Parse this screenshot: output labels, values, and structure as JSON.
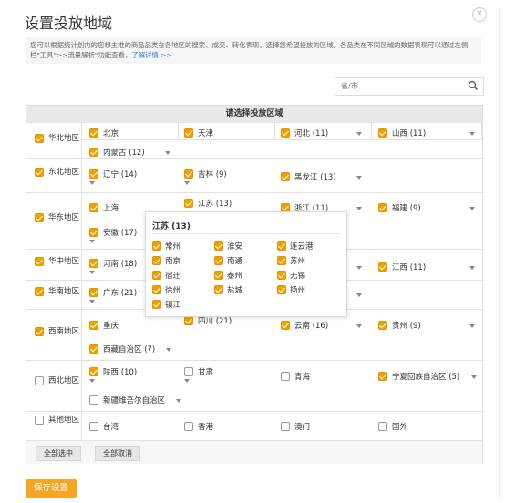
{
  "title": "设置投放地域",
  "close_icon": "close-icon",
  "description": "您可以根据统计划内的您想主推的商品品类在各地区的搜索、成交、转化表现，选择您希望投放的区域。各品类在不同区域的数据表现可以通过左侧栏\"工具\">>流量解析\"功能查看，",
  "description_link": "了解详情 >>",
  "search": {
    "placeholder": "省/市",
    "icon": "search-icon"
  },
  "panel_header": "请选择投放区域",
  "regions": [
    {
      "name": "华北地区",
      "checked": true
    },
    {
      "name": "东北地区",
      "checked": true
    },
    {
      "name": "华东地区",
      "checked": true
    },
    {
      "name": "华中地区",
      "checked": true
    },
    {
      "name": "华南地区",
      "checked": true
    },
    {
      "name": "西南地区",
      "checked": true
    },
    {
      "name": "西北地区",
      "checked": false
    },
    {
      "name": "其他地区",
      "checked": false
    }
  ],
  "provinces": {
    "beijing": "北京",
    "tianjin": "天津",
    "hebei": "河北 (11)",
    "shanxi": "山西 (11)",
    "neimenggu": "内蒙古 (12)",
    "liaoning": "辽宁 (14)",
    "jilin": "吉林 (9)",
    "heilongjiang": "黑龙江 (13)",
    "shanghai": "上海",
    "jiangsu": "江苏 (13)",
    "zhejiang": "浙江 (11)",
    "fujian": "福建 (9)",
    "anhui": "安徽 (17)",
    "henan": "河南 (18)",
    "jiangxi": "江西 (11)",
    "guangdong": "广东 (21)",
    "chongqing": "重庆",
    "sichuan": "四川 (21)",
    "yunnan": "云南 (16)",
    "guizhou": "贵州 (9)",
    "xizang": "西藏自治区 (7)",
    "shaanxi": "陕西 (10)",
    "gansu": "甘肃",
    "qinghai": "青海",
    "ningxia": "宁夏回族自治区 (5)",
    "xinjiang": "新疆维吾尔自治区",
    "taiwan": "台湾",
    "xianggang": "香港",
    "aomen": "澳门",
    "guowai": "国外"
  },
  "popup": {
    "title": "江苏 (13)",
    "cities": [
      "常州",
      "淮安",
      "连云港",
      "南京",
      "南通",
      "苏州",
      "宿迁",
      "泰州",
      "无锡",
      "徐州",
      "盐城",
      "扬州",
      "镇江"
    ]
  },
  "buttons": {
    "select_all": "全部选中",
    "cancel_all": "全部取消",
    "save": "保存设置"
  },
  "colors": {
    "accent": "#f5a623",
    "link": "#2a78d6"
  }
}
